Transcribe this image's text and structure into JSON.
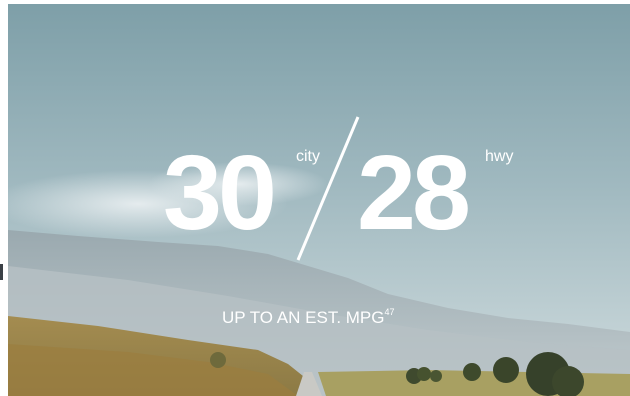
{
  "hero": {
    "city_value": "30",
    "city_label": "city",
    "hwy_value": "28",
    "hwy_label": "hwy",
    "caption_text": "UP TO AN EST. MPG",
    "caption_footnote": "47"
  },
  "colors": {
    "sky_top": "#7e9fa8",
    "sky_bottom": "#c4d5d9",
    "mountain": "#a7b3b7",
    "field": "#a89256",
    "text": "#ffffff"
  }
}
